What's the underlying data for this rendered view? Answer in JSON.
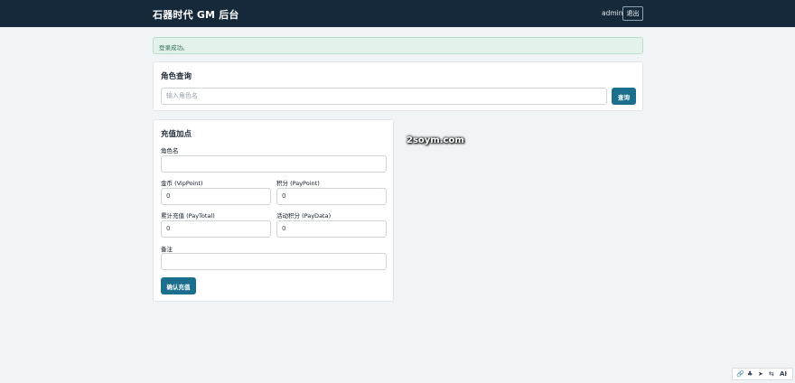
{
  "header": {
    "title": "石器时代 GM 后台",
    "username": "admin",
    "logout_label": "退出"
  },
  "alert": {
    "message": "登录成功。"
  },
  "role_query": {
    "title": "角色查询",
    "input_placeholder": "输入角色名",
    "search_label": "查询"
  },
  "recharge": {
    "title": "充值加点",
    "role_name_label": "角色名",
    "role_name_value": "",
    "vip_point_label": "金币 (VipPoint)",
    "vip_point_value": "0",
    "pay_point_label": "积分 (PayPoint)",
    "pay_point_value": "0",
    "pay_total_label": "累计充值 (PayTotal)",
    "pay_total_value": "0",
    "pay_data_label": "活动积分 (PayData)",
    "pay_data_value": "0",
    "remark_label": "备注",
    "remark_value": "",
    "confirm_label": "确认充值"
  },
  "watermark": "2soym.com",
  "tray": {
    "icons": [
      "link-icon",
      "microphone-icon",
      "send-icon",
      "translate-icon",
      "ai-icon"
    ],
    "ai_label": "AI"
  }
}
